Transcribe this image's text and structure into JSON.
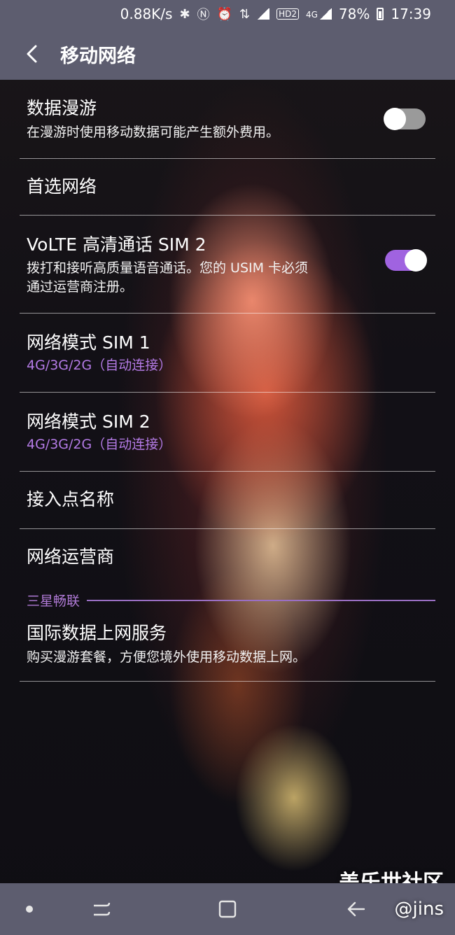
{
  "status_bar": {
    "net_speed": "0.88K/s",
    "icons": [
      "bluetooth-icon",
      "nfc-icon",
      "alarm-icon",
      "data-arrows-icon",
      "signal-icon",
      "hd-icon",
      "lte-signal-icon"
    ],
    "hd_label": "HD2",
    "network_label": "4G",
    "battery_percent": "78%",
    "battery_level": 0.78,
    "time": "17:39"
  },
  "app_bar": {
    "title": "移动网络",
    "back_icon": "back-arrow-icon"
  },
  "settings": {
    "data_roaming": {
      "title": "数据漫游",
      "desc": "在漫游时使用移动数据可能产生额外费用。",
      "enabled": false
    },
    "preferred_network": {
      "title": "首选网络"
    },
    "volte": {
      "title": "VoLTE 高清通话 SIM 2",
      "desc_line1": "拨打和接听高质量语音通话。您的 USIM 卡必须",
      "desc_line2": "通过运营商注册。",
      "enabled": true
    },
    "network_mode_sim1": {
      "title": "网络模式 SIM 1",
      "value": "4G/3G/2G（自动连接）"
    },
    "network_mode_sim2": {
      "title": "网络模式 SIM 2",
      "value": "4G/3G/2G（自动连接）"
    },
    "apn": {
      "title": "接入点名称"
    },
    "operator": {
      "title": "网络运营商"
    },
    "section_header": "三星畅联",
    "intl_data": {
      "title": "国际数据上网服务",
      "desc": "购买漫游套餐，方便您境外使用移动数据上网。"
    }
  },
  "watermark": {
    "line1": "盖乐世社区",
    "line2": "@jins"
  },
  "nav_bar": {
    "icons": [
      "dot-icon",
      "recents-icon",
      "home-icon",
      "back-icon"
    ]
  },
  "colors": {
    "bar_bg": "#5d5d6f",
    "accent": "#a063e0",
    "accent_text": "#b47be6"
  }
}
